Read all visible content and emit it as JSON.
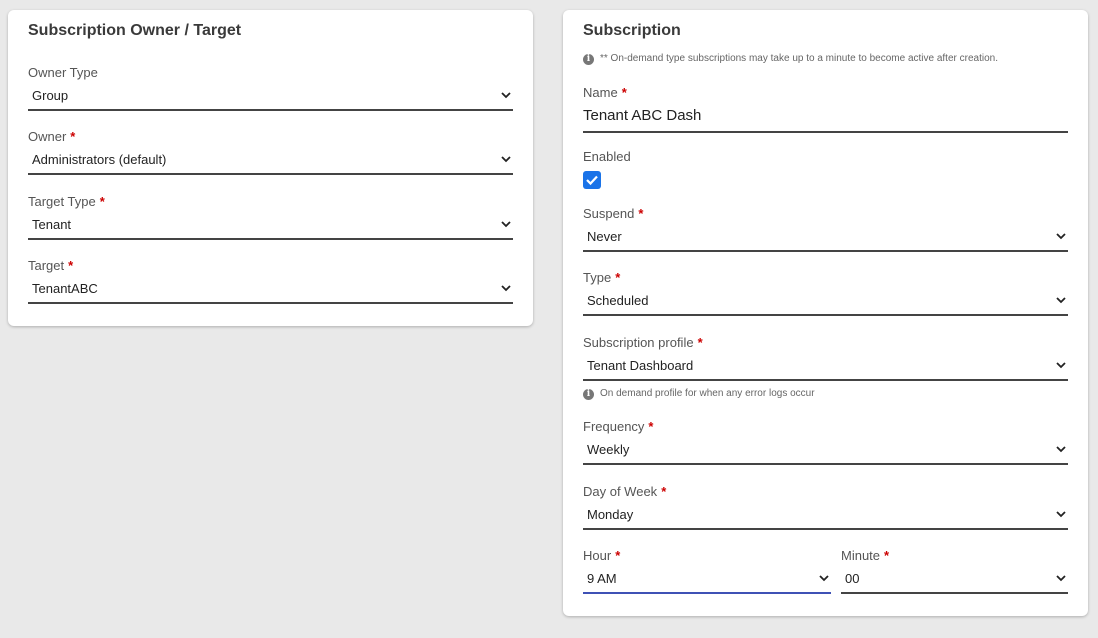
{
  "left_card": {
    "title": "Subscription Owner / Target",
    "owner_type": {
      "label": "Owner Type",
      "value": "Group"
    },
    "owner": {
      "label": "Owner",
      "value": "Administrators (default)"
    },
    "target_type": {
      "label": "Target Type",
      "value": "Tenant"
    },
    "target": {
      "label": "Target",
      "value": "TenantABC"
    }
  },
  "right_card": {
    "title": "Subscription",
    "note": "** On-demand type subscriptions may take up to a minute to become active after creation.",
    "name": {
      "label": "Name",
      "value": "Tenant ABC Dash"
    },
    "enabled": {
      "label": "Enabled",
      "checked": true
    },
    "suspend": {
      "label": "Suspend",
      "value": "Never"
    },
    "type": {
      "label": "Type",
      "value": "Scheduled"
    },
    "profile": {
      "label": "Subscription profile",
      "value": "Tenant Dashboard",
      "hint": "On demand profile for when any error logs occur"
    },
    "frequency": {
      "label": "Frequency",
      "value": "Weekly"
    },
    "day_of_week": {
      "label": "Day of Week",
      "value": "Monday"
    },
    "hour": {
      "label": "Hour",
      "value": "9 AM"
    },
    "minute": {
      "label": "Minute",
      "value": "00"
    }
  },
  "required_marker": "*",
  "info_icon_glyph": "i",
  "colors": {
    "required": "#cc0000",
    "checkbox": "#1a73e8",
    "focus_underline": "#3f51b5"
  }
}
